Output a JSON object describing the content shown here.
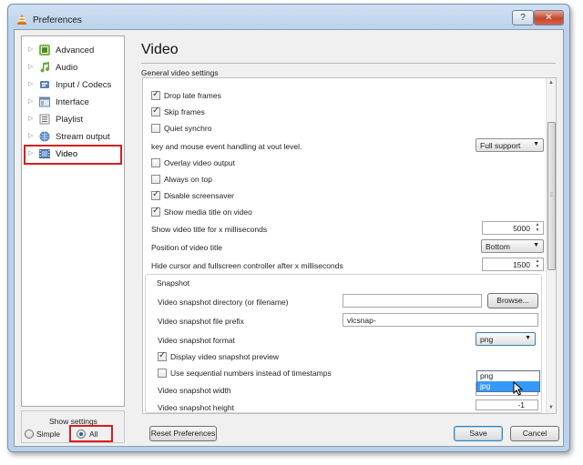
{
  "window": {
    "title": "Preferences",
    "help_glyph": "?",
    "close_glyph": "✕"
  },
  "nav": {
    "items": [
      {
        "label": "Advanced",
        "icon": "advanced-icon",
        "color": "#7ab648"
      },
      {
        "label": "Audio",
        "icon": "audio-icon",
        "color": "#6aa63a"
      },
      {
        "label": "Input / Codecs",
        "icon": "input-codecs-icon",
        "color": "#5b7fb8"
      },
      {
        "label": "Interface",
        "icon": "interface-icon",
        "color": "#6c86a8"
      },
      {
        "label": "Playlist",
        "icon": "playlist-icon",
        "color": "#8a8a8a"
      },
      {
        "label": "Stream output",
        "icon": "stream-output-icon",
        "color": "#4f7fbf"
      },
      {
        "label": "Video",
        "icon": "video-icon",
        "color": "#3b5f9a",
        "selected": true
      }
    ]
  },
  "show_settings": {
    "label": "Show settings",
    "simple_label": "Simple",
    "all_label": "All",
    "selected": "All"
  },
  "page": {
    "title": "Video",
    "section": "General video settings",
    "options": {
      "drop_late_frames": {
        "label": "Drop late frames",
        "checked": true
      },
      "skip_frames": {
        "label": "Skip frames",
        "checked": true
      },
      "quiet_synchro": {
        "label": "Quiet synchro",
        "checked": false
      },
      "key_mouse_label": "key and mouse event handling at vout level.",
      "key_mouse_value": "Full support",
      "overlay_video_output": {
        "label": "Overlay video output",
        "checked": false
      },
      "always_on_top": {
        "label": "Always on top",
        "checked": false
      },
      "disable_screensaver": {
        "label": "Disable screensaver",
        "checked": true
      },
      "show_media_title": {
        "label": "Show media title on video",
        "checked": true
      },
      "show_title_ms_label": "Show video title for x milliseconds",
      "show_title_ms_value": "5000",
      "position_label": "Position of video title",
      "position_value": "Bottom",
      "hide_cursor_label": "Hide cursor and fullscreen controller after x milliseconds",
      "hide_cursor_value": "1500"
    },
    "snapshot": {
      "group_title": "Snapshot",
      "directory_label": "Video snapshot directory (or filename)",
      "directory_value": "",
      "browse_label": "Browse...",
      "prefix_label": "Video snapshot file prefix",
      "prefix_value": "vlcsnap-",
      "format_label": "Video snapshot format",
      "format_value": "png",
      "format_options": [
        "png",
        "jpg"
      ],
      "format_highlighted": "jpg",
      "display_preview": {
        "label": "Display video snapshot preview",
        "checked": true
      },
      "sequential_numbers": {
        "label": "Use sequential numbers instead of timestamps",
        "checked": false
      },
      "width_label": "Video snapshot width",
      "width_value": "-1",
      "height_label": "Video snapshot height",
      "height_value": "-1"
    }
  },
  "buttons": {
    "reset": "Reset Preferences",
    "save": "Save",
    "cancel": "Cancel"
  },
  "colors": {
    "highlight": "#3399ff",
    "annotation_red": "#d81e1e",
    "title_bar": "#b9d1ea"
  }
}
